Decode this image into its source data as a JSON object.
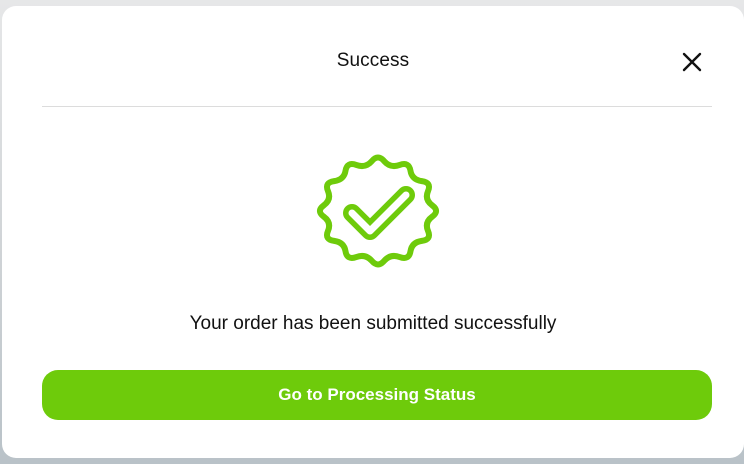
{
  "dialog": {
    "title": "Success",
    "message": "Your order has been submitted successfully",
    "primary_button_label": "Go to Processing Status",
    "close_icon": "close-icon",
    "status_icon": "verified-badge-check-icon"
  },
  "colors": {
    "accent": "#6ecb0b",
    "title_text": "#111111",
    "button_text": "#ffffff"
  }
}
